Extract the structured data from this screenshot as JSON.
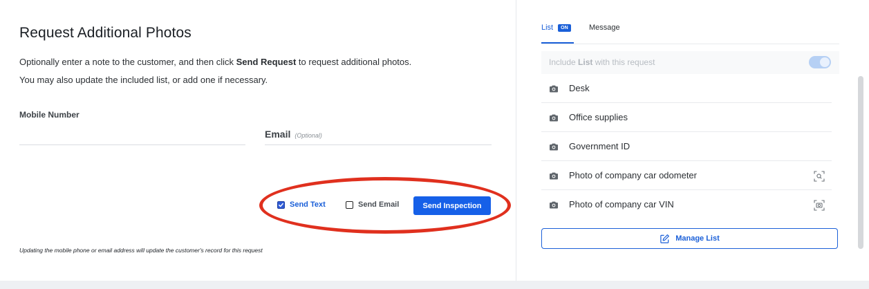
{
  "request": {
    "title": "Request Additional Photos",
    "intro_prefix": "Optionally enter a note to the customer, and then click ",
    "intro_bold": "Send Request",
    "intro_suffix": " to request additional photos.",
    "intro_line2": "You may also update the included list, or add one if necessary.",
    "mobile_label": "Mobile Number",
    "mobile_value": "",
    "email_label": "Email",
    "email_optional": "(Optional)",
    "email_value": "",
    "send_text_label": "Send Text",
    "send_text_checked": true,
    "send_email_label": "Send Email",
    "send_email_checked": false,
    "send_button": "Send Inspection",
    "footnote": "Updating the mobile phone or email address will update the customer's record for this request"
  },
  "sidebar": {
    "tabs": [
      {
        "label": "List",
        "badge": "ON",
        "active": true
      },
      {
        "label": "Message",
        "active": false
      }
    ],
    "include_prefix": "Include ",
    "include_bold": "List",
    "include_suffix": " with this request",
    "include_enabled": true,
    "items": [
      {
        "label": "Desk",
        "icon": "camera-icon",
        "action_icon": null
      },
      {
        "label": "Office supplies",
        "icon": "camera-icon",
        "action_icon": null
      },
      {
        "label": "Government ID",
        "icon": "camera-icon",
        "action_icon": null
      },
      {
        "label": "Photo of company car odometer",
        "icon": "camera-icon",
        "action_icon": "scan-search-icon"
      },
      {
        "label": "Photo of company car VIN",
        "icon": "camera-icon",
        "action_icon": "scan-camera-icon"
      }
    ],
    "manage_button": "Manage List"
  },
  "colors": {
    "accent": "#1660e8",
    "annotation": "#e0301e"
  }
}
